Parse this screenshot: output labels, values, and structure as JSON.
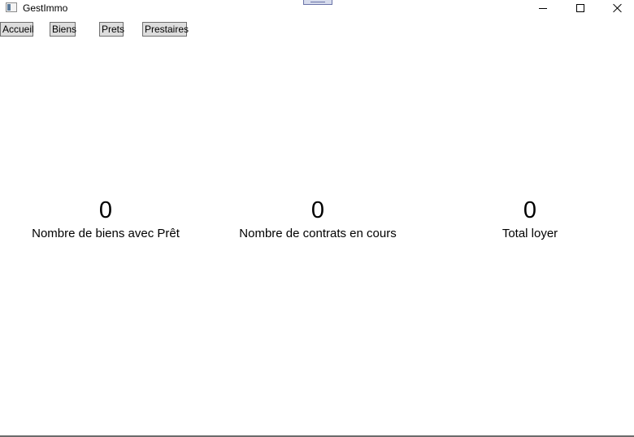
{
  "window": {
    "title": "GestImmo",
    "icons": {
      "app": "app-window-icon",
      "minimize": "minimize-icon",
      "maximize": "maximize-icon",
      "close": "close-icon"
    }
  },
  "toolbar": {
    "accueil_label": "Accueil",
    "biens_label": "Biens",
    "prets_label": "Prets",
    "prestaires_label": "Prestaires"
  },
  "stats": [
    {
      "value": "0",
      "label": "Nombre de biens avec Prêt"
    },
    {
      "value": "0",
      "label": "Nombre de contrats en cours"
    },
    {
      "value": "0",
      "label": "Total loyer"
    }
  ]
}
